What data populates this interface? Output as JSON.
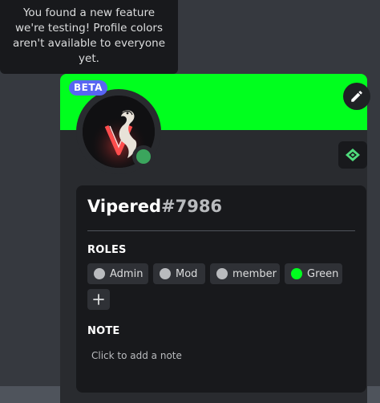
{
  "tooltip": {
    "line1": "You found a new feature",
    "line2": "we're testing! Profile colors",
    "line3": "aren't available to everyone",
    "line4": "yet."
  },
  "profile": {
    "badge": "BETA",
    "banner_color": "#00ff1e",
    "status": "online",
    "status_color": "#3ba55d",
    "username": "Vipered",
    "discriminator": "#7986"
  },
  "roles": {
    "title": "ROLES",
    "items": [
      {
        "label": "Admin",
        "color": "#b9bbbe"
      },
      {
        "label": "Mod",
        "color": "#b9bbbe"
      },
      {
        "label": "member",
        "color": "#b9bbbe"
      },
      {
        "label": "Green",
        "color": "#00ff1e"
      }
    ],
    "add_icon": "plus-icon"
  },
  "note": {
    "title": "NOTE",
    "placeholder": "Click to add a note"
  },
  "icons": {
    "edit": "pencil-icon",
    "nitro": "nitro-gem-icon"
  }
}
